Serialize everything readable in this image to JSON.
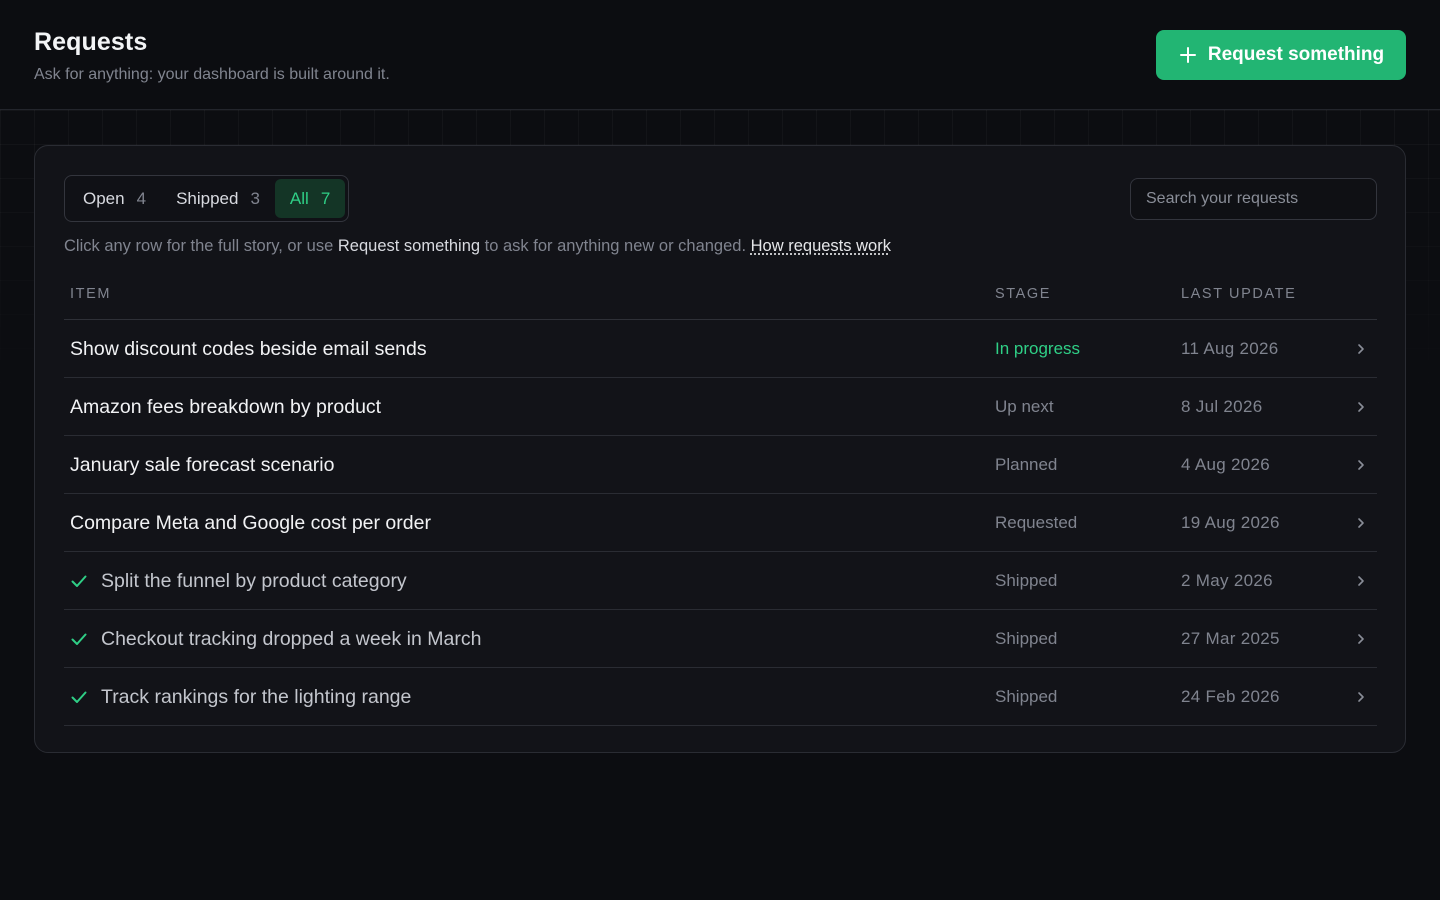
{
  "header": {
    "title": "Requests",
    "subtitle": "Ask for anything: your dashboard is built around it.",
    "primary_button": "Request something"
  },
  "tabs": [
    {
      "label": "Open",
      "count": "4",
      "active": false
    },
    {
      "label": "Shipped",
      "count": "3",
      "active": false
    },
    {
      "label": "All",
      "count": "7",
      "active": true
    }
  ],
  "search": {
    "placeholder": "Search your requests",
    "value": ""
  },
  "help": {
    "prefix": "Click any row for the full story, or use ",
    "strong": "Request something",
    "suffix": " to ask for anything new or changed. ",
    "link": "How requests work"
  },
  "table": {
    "columns": {
      "item": "ITEM",
      "stage": "STAGE",
      "last_update": "LAST UPDATE"
    },
    "rows": [
      {
        "item": "Show discount codes beside email sends",
        "stage": "In progress",
        "last_update": "11 Aug 2026",
        "shipped": false
      },
      {
        "item": "Amazon fees breakdown by product",
        "stage": "Up next",
        "last_update": "8 Jul 2026",
        "shipped": false
      },
      {
        "item": "January sale forecast scenario",
        "stage": "Planned",
        "last_update": "4 Aug 2026",
        "shipped": false
      },
      {
        "item": "Compare Meta and Google cost per order",
        "stage": "Requested",
        "last_update": "19 Aug 2026",
        "shipped": false
      },
      {
        "item": "Split the funnel by product category",
        "stage": "Shipped",
        "last_update": "2 May 2026",
        "shipped": true
      },
      {
        "item": "Checkout tracking dropped a week in March",
        "stage": "Shipped",
        "last_update": "27 Mar 2025",
        "shipped": true
      },
      {
        "item": "Track rankings for the lighting range",
        "stage": "Shipped",
        "last_update": "24 Feb 2026",
        "shipped": true
      }
    ]
  },
  "colors": {
    "accent": "#22b573",
    "accent_text": "#2fcf86",
    "background": "#0c0d11",
    "panel": "#121318"
  },
  "icons": {
    "primary_button": "plus-icon",
    "shipped_row": "check-icon",
    "row_action": "chevron-right-icon"
  }
}
